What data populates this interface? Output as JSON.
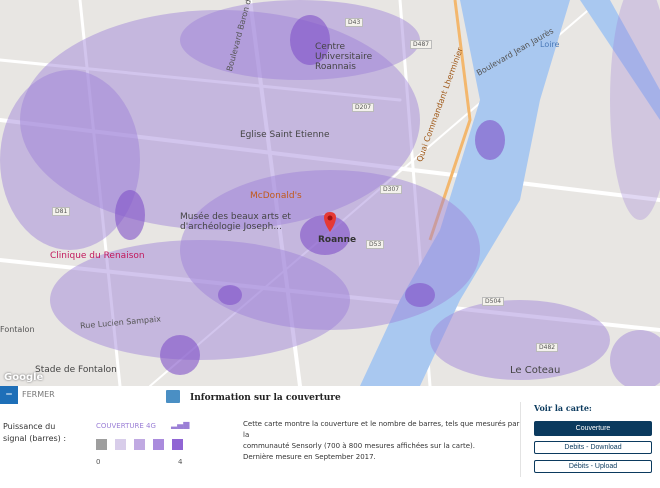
{
  "map": {
    "labels": {
      "centre_univ": "Centre Universitaire Roannais",
      "eglise": "Eglise Saint Etienne",
      "mcdonalds": "McDonald's",
      "musee": "Musée des beaux arts et d'archéologie Joseph...",
      "clinique": "Clinique du Renaison",
      "stade": "Stade de Fontalon",
      "le_coteau": "Le Coteau",
      "loire": "Loire",
      "quai": "Quai Commandant Lherminier",
      "rue_sampaix": "Rue Lucien Sampaix",
      "fontalon": "Fontalon",
      "roanne": "Roanne",
      "bd_baron": "Boulevard Baron du Marais",
      "bd_jean_jaures": "Boulevard Jean Jaurès"
    },
    "roads": [
      "D43",
      "D487",
      "D207",
      "D53",
      "D307",
      "D81",
      "D504",
      "D482"
    ],
    "attribution": "Google",
    "colors": {
      "coverage": "#9b7fd6",
      "water": "#a9c8f0",
      "marker": "#e53935"
    }
  },
  "panel": {
    "close_label": "FERMER",
    "info_title": "Information sur la couverture",
    "signal_label_1": "Puissance du",
    "signal_label_2": "signal (barres) :",
    "legend_title": "COUVERTURE 4G",
    "legend_colors": [
      "#9e9e9e",
      "#d8cdea",
      "#c0a9e2",
      "#aa8bdd",
      "#9065d4"
    ],
    "legend_min": "0",
    "legend_max": "4",
    "description_1": "Cette carte montre la couverture et le nombre de barres, tels que mesurés par la",
    "description_2": "communauté Sensorly (700 à 800 mesures affichées sur la carte).",
    "description_3": "Dernière mesure en September 2017.",
    "voir_label": "Voir la carte:",
    "buttons": [
      "Couverture",
      "Debits - Download",
      "Débits - Upload"
    ]
  }
}
